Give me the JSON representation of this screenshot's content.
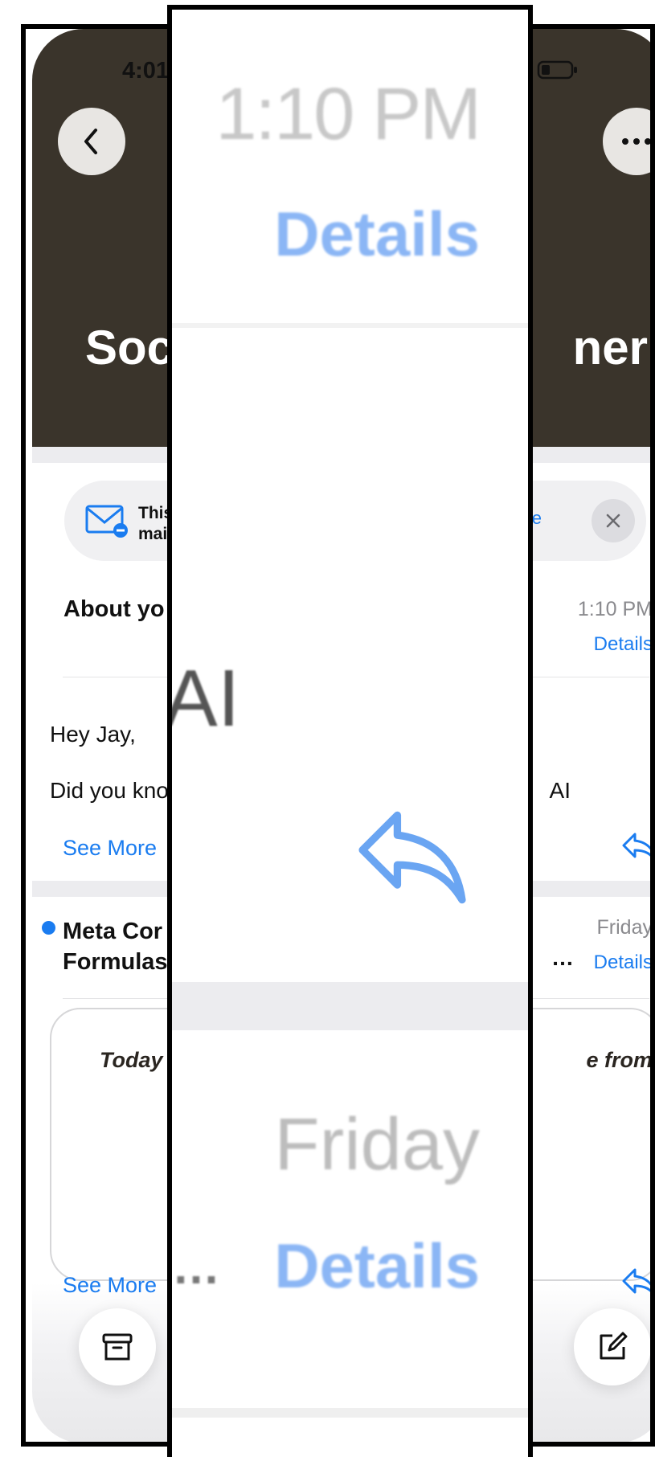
{
  "status_bar": {
    "time": "4:01"
  },
  "header": {
    "title_left": "Soc",
    "title_right": "ner"
  },
  "banner": {
    "text_line1": "This",
    "text_line2": "mai",
    "action": "be"
  },
  "email1": {
    "subject": "About yo",
    "time": "1:10 PM",
    "details": "Details",
    "greeting": "Hey Jay,",
    "body": "Did you kno",
    "body_tail": "AI",
    "see_more": "See More"
  },
  "email2": {
    "sender_line1": "Meta Cor",
    "sender_line2": "Formulas",
    "ellipsis": "…",
    "time": "Friday",
    "details": "Details",
    "card_text_left": "Today",
    "card_text_right": "e from",
    "see_more": "See More"
  },
  "zoom": {
    "time": "1:10 PM",
    "details": "Details",
    "ai": "AI",
    "friday": "Friday",
    "details2": "Details",
    "dots": "…"
  },
  "colors": {
    "header_bg": "#3a342b",
    "accent": "#1a7cf0"
  },
  "icons": [
    "back-chevron-icon",
    "more-icon",
    "mail-unsubscribe-icon",
    "close-icon",
    "reply-icon",
    "archive-icon",
    "compose-icon",
    "wifi-icon",
    "battery-icon"
  ]
}
